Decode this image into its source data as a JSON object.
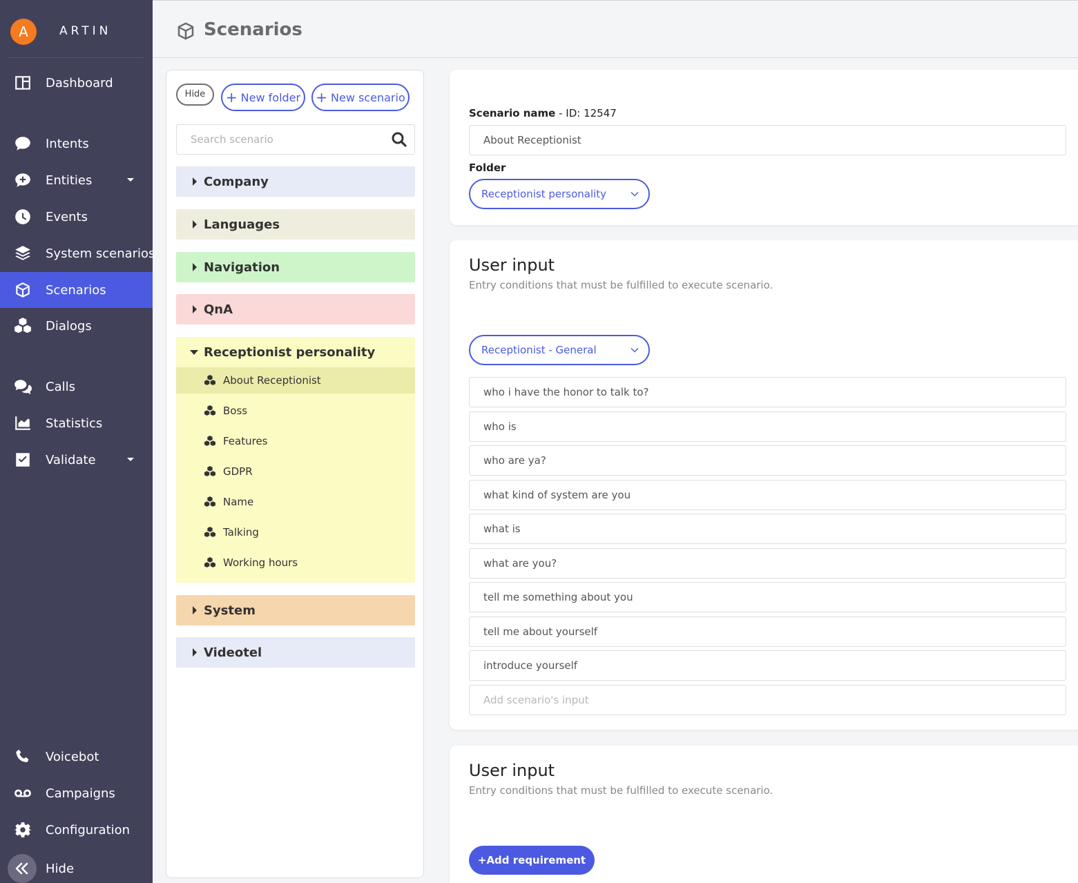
{
  "app": {
    "logo_letter": "A",
    "logo_text": "ARTIN"
  },
  "sidebar": {
    "items": [
      {
        "label": "Dashboard",
        "icon": "dashboard-icon"
      },
      {
        "label": "Intents",
        "icon": "chat-bubble-icon"
      },
      {
        "label": "Entities",
        "icon": "chat-plus-icon",
        "has_caret": true
      },
      {
        "label": "Events",
        "icon": "clock-icon"
      },
      {
        "label": "System scenarios",
        "icon": "layers-icon"
      },
      {
        "label": "Scenarios",
        "icon": "cube-icon",
        "active": true
      },
      {
        "label": "Dialogs",
        "icon": "cubes-icon"
      },
      {
        "label": "Calls",
        "icon": "comments-icon"
      },
      {
        "label": "Statistics",
        "icon": "area-chart-icon"
      },
      {
        "label": "Validate",
        "icon": "checkbox-icon",
        "has_caret": true
      },
      {
        "label": "Voicebot",
        "icon": "phone-icon"
      },
      {
        "label": "Campaigns",
        "icon": "voicemail-icon"
      },
      {
        "label": "Configuration",
        "icon": "gear-icon"
      },
      {
        "label": "Hide",
        "icon": "double-chevron-left-icon"
      }
    ]
  },
  "header": {
    "title": "Scenarios"
  },
  "tree": {
    "hide_label": "Hide",
    "new_folder_label": "New folder",
    "new_scenario_label": "New scenario",
    "search_placeholder": "Search scenario",
    "folders": [
      {
        "name": "Company",
        "color": "#e7eaf7"
      },
      {
        "name": "Languages",
        "color": "#efedde"
      },
      {
        "name": "Navigation",
        "color": "#cdf5c9"
      },
      {
        "name": "QnA",
        "color": "#fbd9d9"
      },
      {
        "name": "Receptionist personality",
        "color": "#fbfbc4",
        "open": true
      },
      {
        "name": "System",
        "color": "#f6d6ad"
      },
      {
        "name": "Videotel",
        "color": "#e7eaf7"
      }
    ],
    "open_items": [
      "About Receptionist",
      "Boss",
      "Features",
      "GDPR",
      "Name",
      "Talking",
      "Working hours"
    ]
  },
  "scenario": {
    "name_label": "Scenario name",
    "id_text": " - ID: 12547",
    "name_value": "About Receptionist",
    "folder_label": "Folder",
    "folder_value": "Receptionist personality"
  },
  "user_input": {
    "title": "User input",
    "subtitle": "Entry conditions that must be fulfilled to execute scenario.",
    "intent_value": "Receptionist - General",
    "inputs": [
      "who i have the honor to talk to?",
      "who is",
      "who are ya?",
      "what kind of system are you",
      "what is",
      "what are you?",
      "tell me something about you",
      "tell me about yourself",
      "introduce yourself"
    ],
    "add_placeholder": "Add scenario's input"
  },
  "user_input_2": {
    "title": "User input",
    "subtitle": "Entry conditions that must be fulfilled to execute scenario.",
    "add_requirement_label": "+Add requirement"
  },
  "colors": {
    "accent": "#4b5ae0",
    "sidebar_bg": "#42415a",
    "logo": "#f47b20"
  }
}
